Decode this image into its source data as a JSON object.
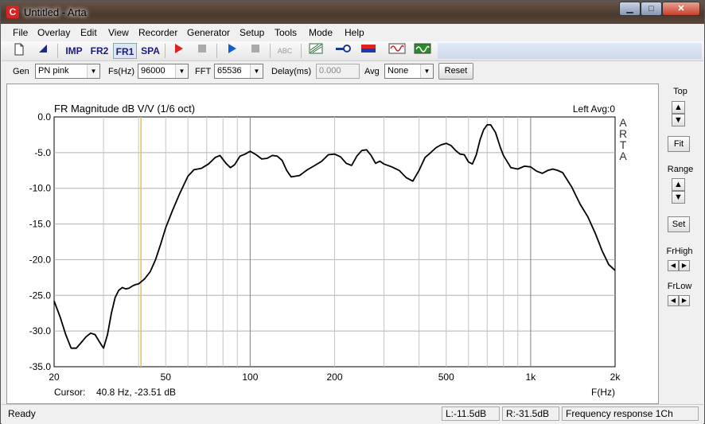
{
  "window": {
    "title": "Untitled - Arta",
    "icon_letter": "C"
  },
  "window_buttons": {
    "min": "▁",
    "max": "□",
    "close": "✕"
  },
  "menu": [
    "File",
    "Overlay",
    "Edit",
    "View",
    "Recorder",
    "Generator",
    "Setup",
    "Tools",
    "Mode",
    "Help"
  ],
  "toolbar": {
    "imp": "IMP",
    "fr2": "FR2",
    "fr1": "FR1",
    "spa": "SPA",
    "abc": "ABC"
  },
  "params": {
    "gen_label": "Gen",
    "gen_value": "PN pink",
    "fs_label": "Fs(Hz)",
    "fs_value": "96000",
    "fft_label": "FFT",
    "fft_value": "65536",
    "delay_label": "Delay(ms)",
    "delay_value": "0.000",
    "avg_label": "Avg",
    "avg_value": "None",
    "reset_label": "Reset"
  },
  "side": {
    "top_label": "Top",
    "fit_label": "Fit",
    "range_label": "Range",
    "set_label": "Set",
    "frhigh_label": "FrHigh",
    "frlow_label": "FrLow"
  },
  "status": {
    "ready": "Ready",
    "left_level": "L:-11.5dB",
    "right_level": "R:-31.5dB",
    "mode": "Frequency response 1Ch"
  },
  "chart_data": {
    "type": "line",
    "title": "FR Magnitude dB V/V (1/6 oct)",
    "channel_info": "Left  Avg:0",
    "watermark": [
      "A",
      "R",
      "T",
      "A"
    ],
    "xlabel": "F(Hz)",
    "x_scale": "log",
    "xlim": [
      20,
      2000
    ],
    "ylim": [
      -35,
      0
    ],
    "x_tick_labels": [
      {
        "value": 20,
        "label": "20"
      },
      {
        "value": 50,
        "label": "50"
      },
      {
        "value": 100,
        "label": "100"
      },
      {
        "value": 200,
        "label": "200"
      },
      {
        "value": 500,
        "label": "500"
      },
      {
        "value": 1000,
        "label": "1k"
      },
      {
        "value": 2000,
        "label": "2k"
      }
    ],
    "y_ticks": [
      0,
      -5,
      -10,
      -15,
      -20,
      -25,
      -30,
      -35
    ],
    "y_tick_labels": [
      "0.0",
      "-5.0",
      "-10.0",
      "-15.0",
      "-20.0",
      "-25.0",
      "-30.0",
      "-35.0"
    ],
    "grid": true,
    "cursor": {
      "label": "Cursor:",
      "text": "40.8 Hz, -23.51 dB",
      "frequency": 40.8,
      "color": "#e6c24a"
    },
    "line_color": "#000000",
    "series": [
      {
        "x": [
          20,
          21,
          22,
          23,
          24,
          25,
          26,
          27,
          28,
          29,
          30,
          31,
          32,
          33,
          34,
          35,
          36,
          37,
          38,
          39,
          40,
          42,
          44,
          46,
          48,
          50,
          53,
          56,
          60,
          63,
          67,
          71,
          75,
          78,
          82,
          85,
          88,
          92,
          96,
          100,
          105,
          110,
          115,
          120,
          125,
          130,
          135,
          140,
          150,
          160,
          170,
          180,
          190,
          200,
          210,
          220,
          230,
          240,
          250,
          260,
          270,
          280,
          290,
          300,
          320,
          340,
          360,
          380,
          400,
          420,
          440,
          460,
          480,
          500,
          520,
          540,
          560,
          580,
          600,
          620,
          640,
          660,
          680,
          700,
          720,
          750,
          780,
          800,
          850,
          900,
          950,
          1000,
          1050,
          1100,
          1150,
          1200,
          1250,
          1300,
          1400,
          1500,
          1600,
          1700,
          1800,
          1900,
          2000
        ],
        "y": [
          -25.8,
          -28,
          -30.5,
          -32.4,
          -32.4,
          -31.6,
          -30.8,
          -30.3,
          -30.5,
          -31.5,
          -32.4,
          -30.5,
          -27.5,
          -25.3,
          -24.3,
          -23.9,
          -24.1,
          -24.0,
          -23.7,
          -23.5,
          -23.4,
          -22.7,
          -21.7,
          -20.0,
          -17.8,
          -15.5,
          -13.0,
          -10.8,
          -8.3,
          -7.4,
          -7.2,
          -6.6,
          -5.7,
          -5.4,
          -6.5,
          -7.1,
          -6.7,
          -5.5,
          -5.2,
          -4.8,
          -5.3,
          -5.9,
          -5.8,
          -5.4,
          -5.5,
          -6.1,
          -7.5,
          -8.4,
          -8.2,
          -7.4,
          -6.8,
          -6.2,
          -5.3,
          -5.2,
          -5.6,
          -6.5,
          -6.8,
          -5.5,
          -4.7,
          -4.6,
          -5.4,
          -6.5,
          -6.2,
          -6.6,
          -7.0,
          -7.5,
          -8.5,
          -9.0,
          -7.5,
          -5.7,
          -5.0,
          -4.3,
          -3.9,
          -3.7,
          -4.0,
          -4.7,
          -5.2,
          -5.3,
          -6.3,
          -6.6,
          -5.3,
          -3.2,
          -1.8,
          -1.1,
          -1.1,
          -2.2,
          -4.3,
          -5.4,
          -7.1,
          -7.3,
          -6.9,
          -7.0,
          -7.6,
          -7.9,
          -7.5,
          -7.3,
          -7.5,
          -7.8,
          -9.8,
          -12.2,
          -14.0,
          -16.3,
          -18.8,
          -20.7,
          -21.5
        ]
      }
    ]
  }
}
